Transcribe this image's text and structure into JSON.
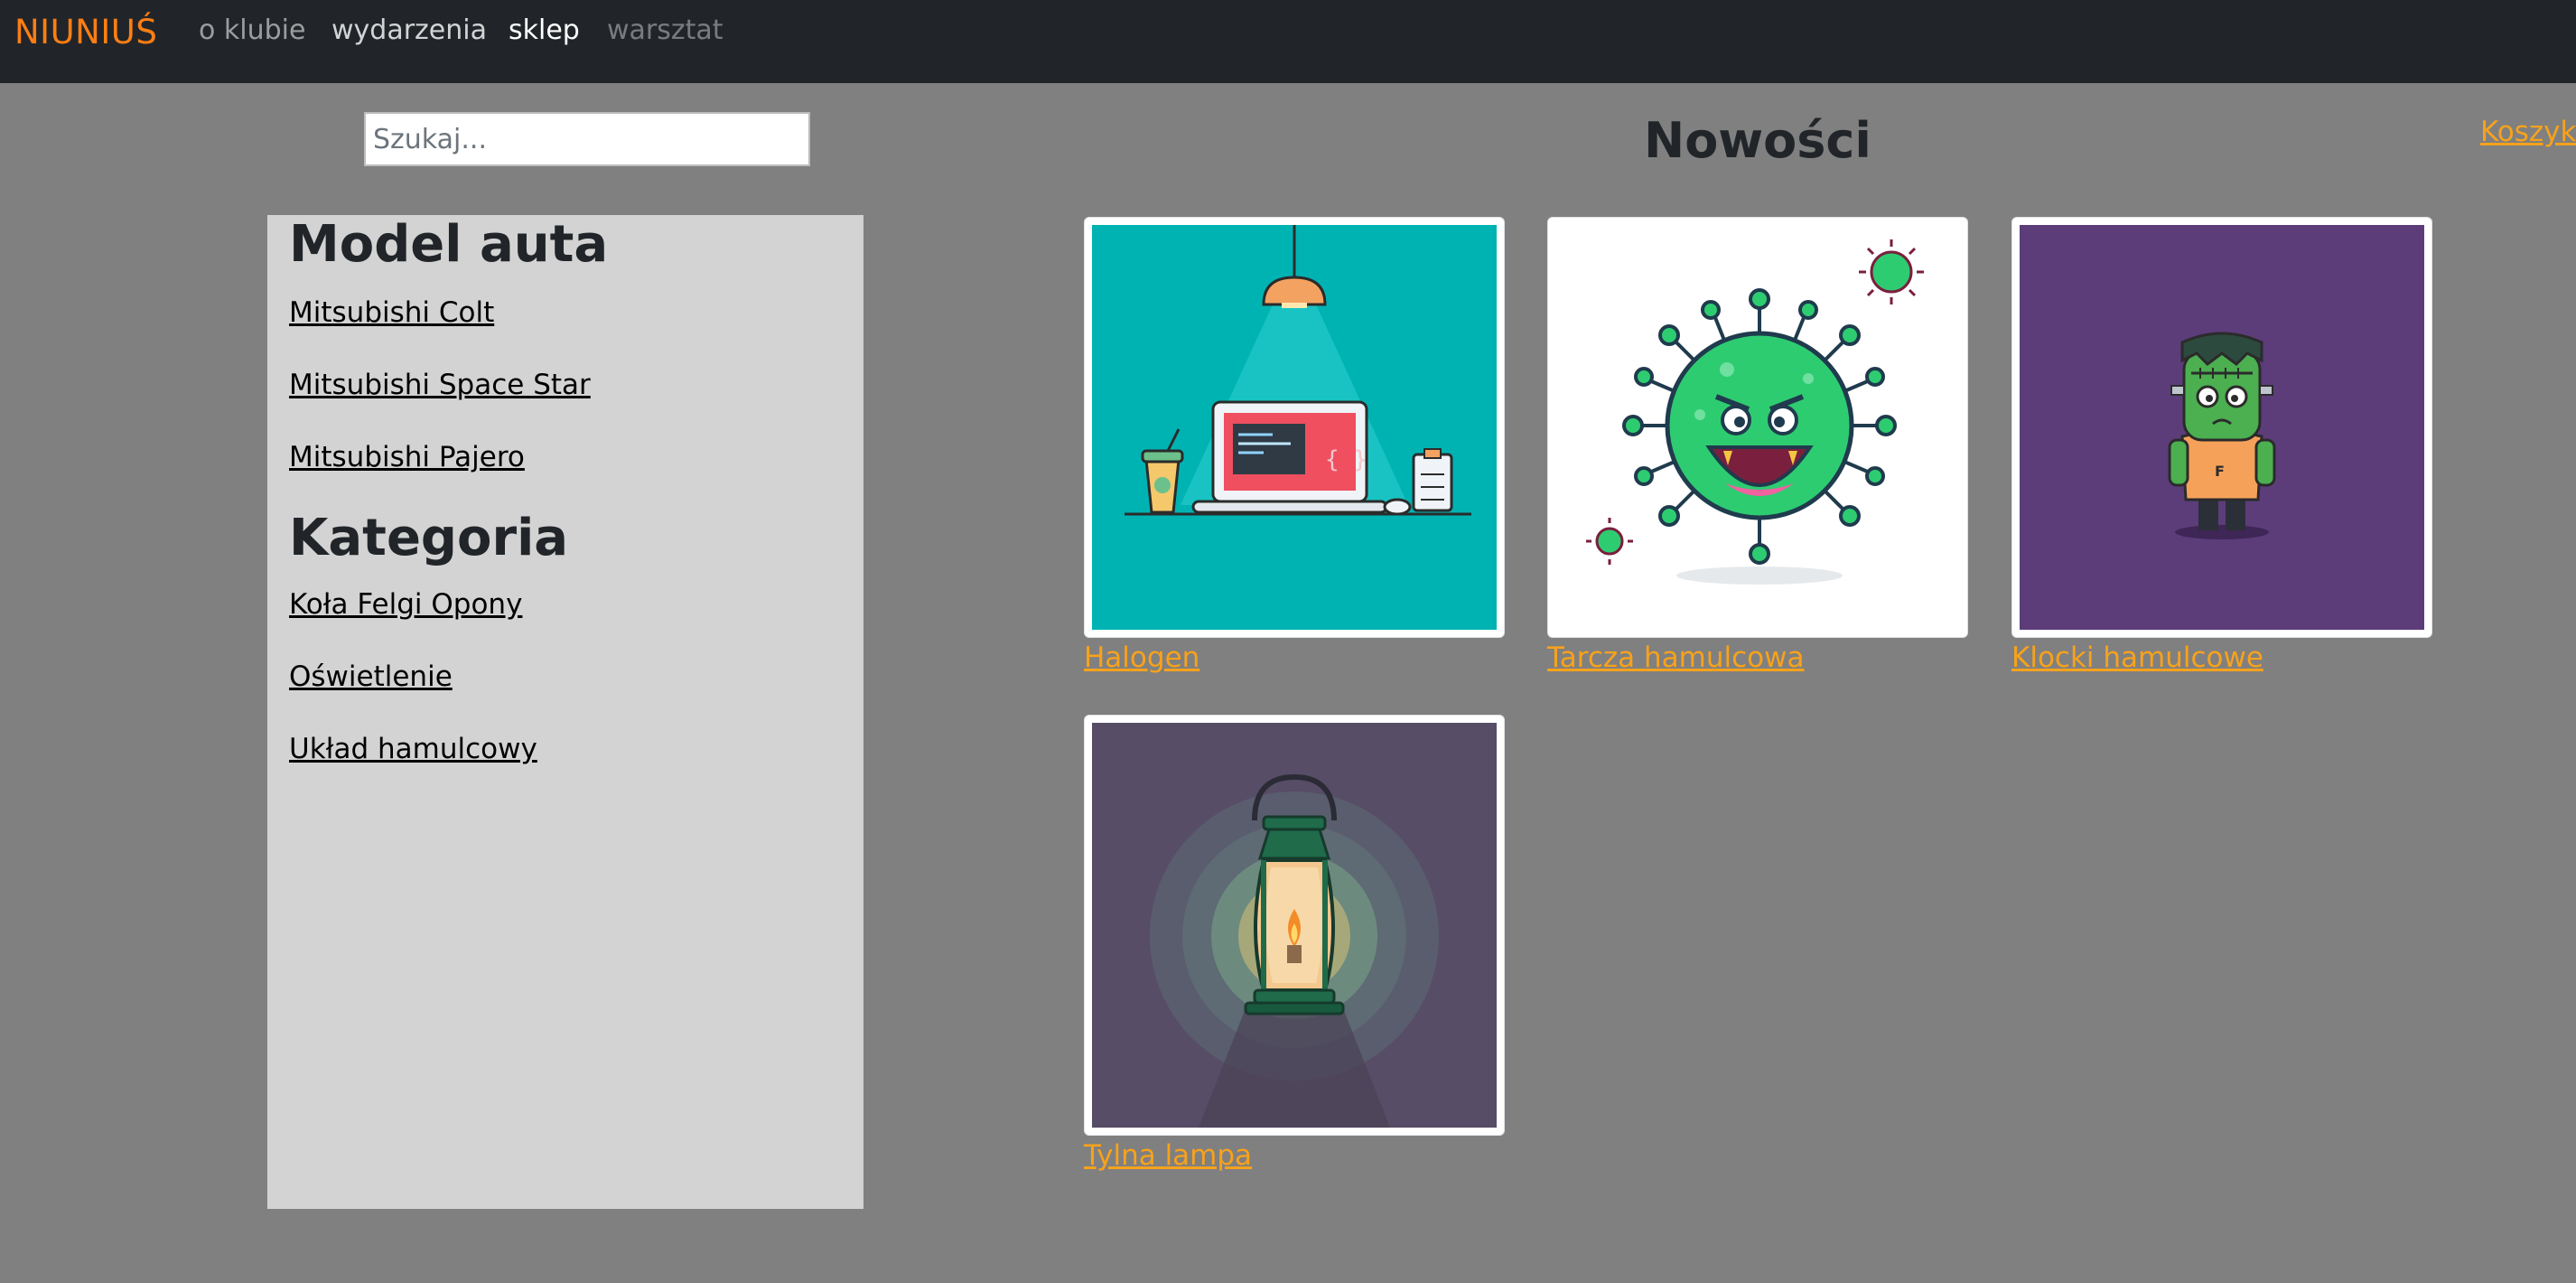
{
  "navbar": {
    "brand": "NIUNIUŚ",
    "links": [
      {
        "label": "o klubie"
      },
      {
        "label": "wydarzenia"
      },
      {
        "label": "sklep"
      },
      {
        "label": "warsztat"
      }
    ]
  },
  "search": {
    "placeholder": "Szukaj..."
  },
  "main": {
    "title": "Nowości"
  },
  "cart": {
    "label": "Koszyk"
  },
  "sidebar": {
    "sections": [
      {
        "heading": "Model auta",
        "items": [
          "Mitsubishi Colt",
          "Mitsubishi Space Star",
          "Mitsubishi Pajero"
        ]
      },
      {
        "heading": "Kategoria",
        "items": [
          "Koła Felgi Opony",
          "Oświetlenie",
          "Układ hamulcowy"
        ]
      }
    ]
  },
  "products": [
    {
      "name": "Halogen",
      "image": "desk-lamp-laptop-illustration"
    },
    {
      "name": "Tarcza hamulcowa",
      "image": "green-virus-illustration"
    },
    {
      "name": "Klocki hamulcowe",
      "image": "frankenstein-character-illustration"
    },
    {
      "name": "Tylna lampa",
      "image": "lantern-illustration"
    }
  ],
  "colors": {
    "navbar_bg": "#212529",
    "brand": "#fd7e14",
    "page_bg": "#808080",
    "sidebar_bg": "#d3d3d3",
    "link_accent": "#f7a21b"
  }
}
